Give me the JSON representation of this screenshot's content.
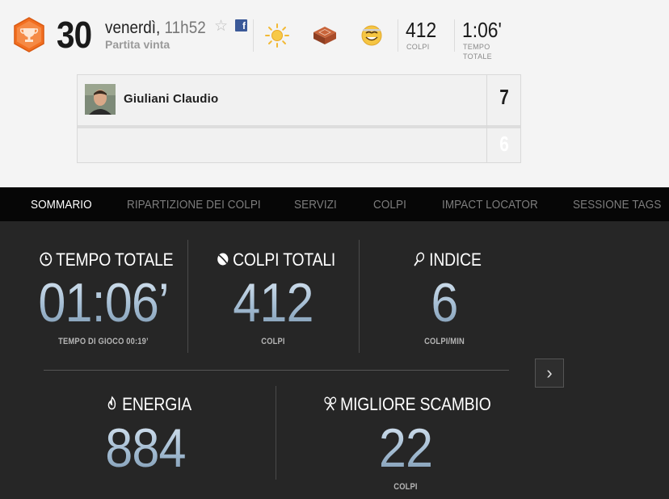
{
  "match": {
    "day": "30",
    "weekday": "venerdì,",
    "time": "11h52",
    "result": "Partita vinta",
    "star_icon": "star-outline-icon",
    "share_icon": "facebook-icon",
    "conditions": [
      "sun-icon",
      "clay-court-icon",
      "smiley-face-icon"
    ],
    "strokes": {
      "value": "412",
      "label": "COLPI"
    },
    "duration": {
      "value": "1:06'",
      "label_line1": "TEMPO",
      "label_line2": "TOTALE"
    }
  },
  "players": [
    {
      "name": "Giuliani Claudio",
      "score": "7"
    },
    {
      "name": "",
      "score": "6"
    }
  ],
  "tabs": [
    {
      "label": "SOMMARIO",
      "active": true
    },
    {
      "label": "RIPARTIZIONE DEI COLPI",
      "active": false
    },
    {
      "label": "SERVIZI",
      "active": false
    },
    {
      "label": "COLPI",
      "active": false
    },
    {
      "label": "IMPACT LOCATOR",
      "active": false
    },
    {
      "label": "SESSIONE TAGS",
      "active": false
    }
  ],
  "summary": {
    "total_time": {
      "icon": "clock-icon",
      "title": "TEMPO TOTALE",
      "value": "01:06’",
      "sub": "TEMPO DI GIOCO 00:19’"
    },
    "total_strokes": {
      "icon": "ball-icon",
      "title": "COLPI TOTALI",
      "value": "412",
      "sub": "COLPI"
    },
    "index": {
      "icon": "racket-icon",
      "title": "INDICE",
      "value": "6",
      "sub": "COLPI/MIN"
    },
    "energy": {
      "icon": "flame-icon",
      "title": "ENERGIA",
      "value": "884",
      "sub": ""
    },
    "best_rally": {
      "icon": "crossed-rackets-icon",
      "title": "MIGLIORE SCAMBIO",
      "value": "22",
      "sub": "COLPI"
    }
  },
  "colors": {
    "badge": "#f26f21",
    "accent_text": "#a3bcd2",
    "tab_bar": "#060606",
    "panel": "#262626"
  }
}
